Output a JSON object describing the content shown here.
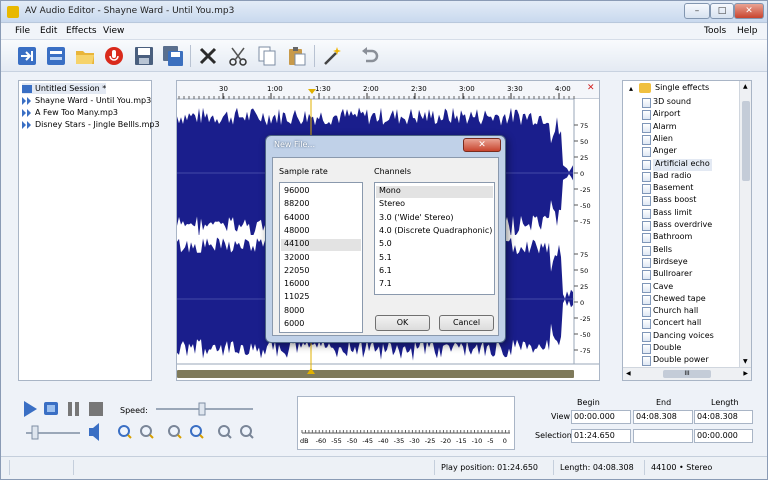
{
  "window": {
    "title": "AV Audio Editor - Shayne Ward - Until You.mp3",
    "buttons": {
      "minimize": "–",
      "maximize": "□",
      "close": "✕"
    }
  },
  "menu": {
    "left": [
      "File",
      "Edit",
      "Effects",
      "View"
    ],
    "right": [
      "Tools",
      "Help"
    ]
  },
  "toolbar": {
    "icons": [
      "import-icon",
      "export-icon",
      "open-folder-icon",
      "record-icon",
      "save-icon",
      "save-all-icon",
      "delete-icon",
      "cut-icon",
      "copy-icon",
      "paste-icon",
      "magic-wand-icon",
      "undo-icon"
    ]
  },
  "session": {
    "items": [
      {
        "label": "Untitled Session *",
        "icon": "session-icon"
      },
      {
        "label": "Shayne Ward - Until You.mp3",
        "icon": "audio-track-icon"
      },
      {
        "label": "A Few Too Many.mp3",
        "icon": "audio-track-icon"
      },
      {
        "label": "Disney Stars - Jingle Bellls.mp3",
        "icon": "audio-track-icon"
      }
    ]
  },
  "waveform": {
    "timeline": [
      "30",
      "1:00",
      "1:30",
      "2:00",
      "2:30",
      "3:00",
      "3:30",
      "4:00"
    ],
    "db_scale_top": [
      "75",
      "50",
      "25",
      "0",
      "-25",
      "-50",
      "-75"
    ],
    "db_scale_bottom": [
      "75",
      "50",
      "25",
      "0",
      "-25",
      "-50",
      "-75"
    ],
    "colors": {
      "wave": "#1a1e8c",
      "background": "#ffffff"
    }
  },
  "effects": {
    "root": "Single effects",
    "items": [
      "3D sound",
      "Airport",
      "Alarm",
      "Alien",
      "Anger",
      "Artificial echo",
      "Bad radio",
      "Basement",
      "Bass boost",
      "Bass limit",
      "Bass overdrive",
      "Bathroom",
      "Bells",
      "Birdseye",
      "Bullroarer",
      "Cave",
      "Chewed tape",
      "Church hall",
      "Concert hall",
      "Dancing voices",
      "Double",
      "Double power"
    ],
    "selected": "Artificial echo",
    "scroll_label": "III"
  },
  "dialog": {
    "title": "New File...",
    "close": "✕",
    "sample_rate_label": "Sample rate",
    "channels_label": "Channels",
    "sample_rates": [
      "96000",
      "88200",
      "64000",
      "48000",
      "44100",
      "32000",
      "22050",
      "16000",
      "11025",
      "8000",
      "6000"
    ],
    "selected_rate": "44100",
    "channels": [
      "Mono",
      "Stereo",
      "3.0 ('Wide' Stereo)",
      "4.0 (Discrete Quadraphonic)",
      "5.0",
      "5.1",
      "6.1",
      "7.1"
    ],
    "selected_channel": "Mono",
    "ok": "OK",
    "cancel": "Cancel"
  },
  "transport": {
    "speed_label": "Speed:"
  },
  "meter": {
    "ticks": [
      "dB",
      "-60",
      "-55",
      "-50",
      "-45",
      "-40",
      "-35",
      "-30",
      "-25",
      "-20",
      "-15",
      "-10",
      "-5",
      "0"
    ]
  },
  "selection": {
    "headers": {
      "begin": "Begin",
      "end": "End",
      "length": "Length"
    },
    "view_label": "View",
    "selection_label": "Selection",
    "view_begin": "00:00.000",
    "view_end": "04:08.308",
    "view_length": "04:08.308",
    "sel_begin": "01:24.650",
    "sel_end": "",
    "sel_length": "00:00.000"
  },
  "status": {
    "play_position": "Play position: 01:24.650",
    "length": "Length: 04:08.308",
    "format": "44100 • Stereo"
  }
}
